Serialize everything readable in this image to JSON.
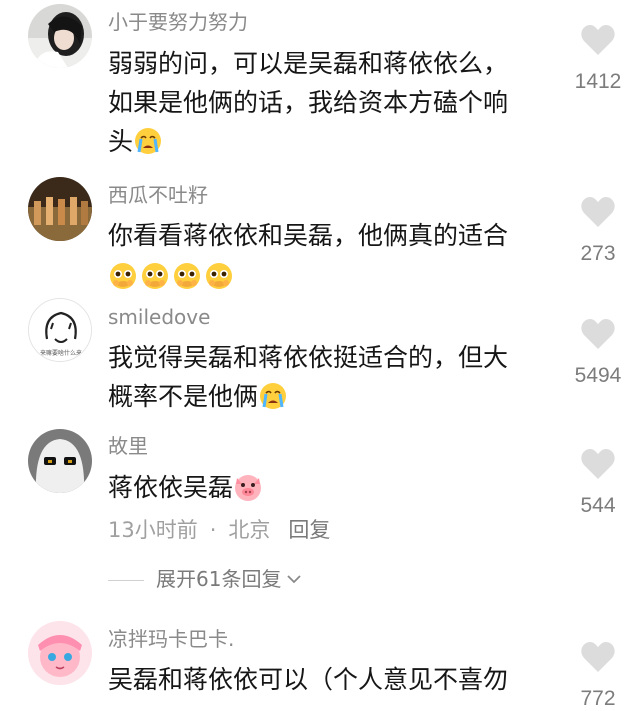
{
  "comments": [
    {
      "username": "小于要努力努力",
      "lines": [
        "弱弱的问，可以是吴磊和蒋依依么，",
        "如果是他俩的话，我给资本方磕个响",
        "头"
      ],
      "likes": "1412",
      "emoji": "crying-face"
    },
    {
      "username": "西瓜不吐籽",
      "lines": [
        "你看看蒋依依和吴磊，他俩真的适合"
      ],
      "likes": "273",
      "emoji": "pleading-face"
    },
    {
      "username": "smiledove",
      "lines": [
        "我觉得吴磊和蒋依依挺适合的，但大",
        "概率不是他俩"
      ],
      "likes": "5494",
      "emoji": "crying-face",
      "avatar_text": "来嘛要啥什么来"
    },
    {
      "username": "故里",
      "lines": [
        "蒋依依吴磊"
      ],
      "likes": "544",
      "emoji": "pig-face",
      "time": "13小时前",
      "location": "北京",
      "reply_label": "回复",
      "expand_label": "展开61条回复"
    },
    {
      "username": "凉拌玛卡巴卡.",
      "lines": [
        "吴磊和蒋依依可以（个人意见不喜勿"
      ],
      "likes": "772"
    }
  ],
  "colors": {
    "username": "#8a8a8a",
    "text": "#161616",
    "heart": "#dcdcdc",
    "like_count": "#7c7c7c"
  }
}
